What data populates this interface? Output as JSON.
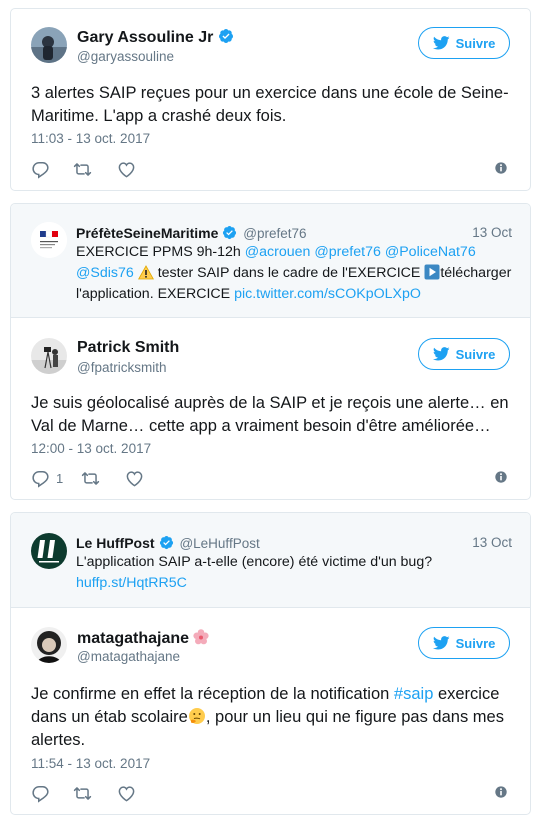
{
  "colors": {
    "accent": "#1da1f2",
    "muted": "#657786",
    "border": "#e1e8ed",
    "quote_bg": "#f5f8fa"
  },
  "follow_label": "Suivre",
  "tweets": [
    {
      "name": "Gary Assouline Jr",
      "handle": "@garyassouline",
      "text": "3 alertes SAIP reçues pour un exercice dans une école de Seine-Maritime. L'app a crashé deux fois.",
      "time": "11:03 - 13 oct. 2017"
    },
    {
      "quote": {
        "name": "PréfèteSeineMaritime",
        "handle": "@prefet76",
        "date": "13 Oct",
        "text_parts": {
          "p1": "EXERCICE PPMS 9h-12h ",
          "m1": "@acrouen",
          "m2": "@prefet76",
          "m3": "@PoliceNat76",
          "m4": "@Sdis76",
          "p2": "tester SAIP dans le cadre de l'EXERCICE ",
          "p3": "télécharger l'application. EXERCICE ",
          "link": "pic.twitter.com/sCOKpOLXpO"
        }
      },
      "name": "Patrick Smith",
      "handle": "@fpatricksmith",
      "text": "Je suis géolocalisé auprès de la SAIP et je reçois une alerte… en Val de Marne… cette app a vraiment besoin d'être améliorée…",
      "time": "12:00 - 13 oct. 2017",
      "reply_count": "1"
    },
    {
      "quote": {
        "name": "Le HuffPost",
        "handle": "@LeHuffPost",
        "date": "13 Oct",
        "text": "L'application SAIP a-t-elle (encore) été victime d'un bug?",
        "link": "huffp.st/HqtRR5C"
      },
      "name": "matagathajane",
      "handle": "@matagathajane",
      "text_parts": {
        "p1": "Je confirme en effet la réception de la notification ",
        "hashtag": "#saip",
        "p2": " exercice dans un étab scolaire",
        "p3": ", pour un lieu qui ne figure pas dans mes alertes."
      },
      "time": "11:54 - 13 oct. 2017"
    }
  ]
}
